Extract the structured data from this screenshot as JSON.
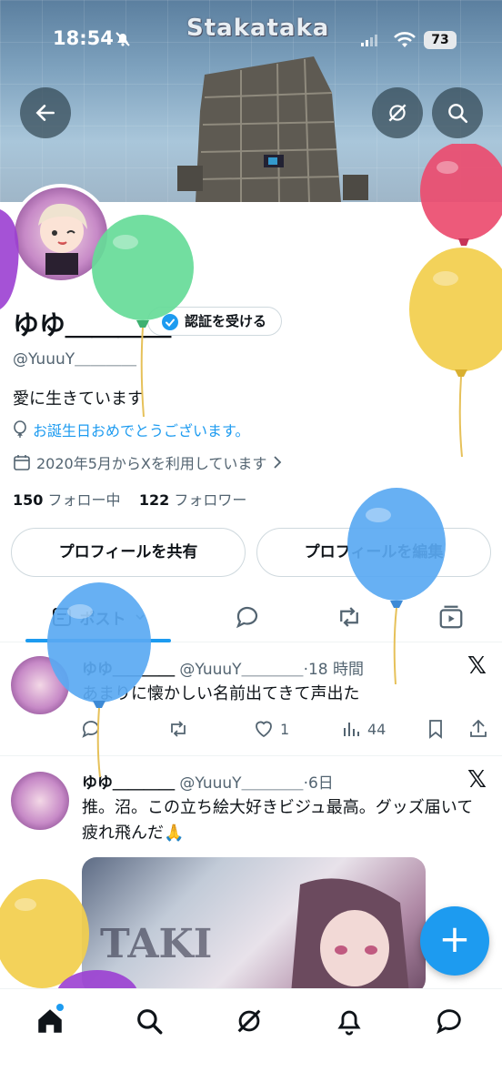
{
  "status_bar": {
    "time": "18:54",
    "battery": "73"
  },
  "banner": {
    "title": "Stakataka"
  },
  "profile": {
    "name": "ゆゆ＿＿＿＿",
    "handle": "@YuuuY＿＿＿＿",
    "verify_button": "認証を受ける",
    "bio": "愛に生きています",
    "birthday_text": "お誕生日おめでとうございます。",
    "joined_text": "2020年5月からXを利用しています",
    "following_count": "150",
    "following_label": "フォロー中",
    "followers_count": "122",
    "followers_label": "フォロワー"
  },
  "buttons": {
    "share": "プロフィールを共有",
    "edit": "プロフィールを編集"
  },
  "tabs": [
    {
      "label": "ポスト",
      "icon": "posts-icon",
      "active": true
    },
    {
      "label": "",
      "icon": "reply-icon"
    },
    {
      "label": "",
      "icon": "repost-icon"
    },
    {
      "label": "",
      "icon": "media-icon"
    }
  ],
  "posts": [
    {
      "name": "ゆゆ＿＿＿＿",
      "handle": "@YuuuY＿＿＿＿",
      "time": "18 時間",
      "text": "あまりに懐かしい名前出てきて声出た",
      "likes": "1",
      "views": "44"
    },
    {
      "name": "ゆゆ＿＿＿＿",
      "handle": "@YuuuY＿＿＿＿",
      "time": "6日",
      "text": "推。沼。この立ち絵大好きビジュ最高。グッズ届いて疲れ飛んだ🙏",
      "media_label": "TAKI"
    }
  ],
  "fab_label": "+",
  "colors": {
    "accent": "#1d9bf0",
    "text": "#0f1419",
    "secondary": "#536471"
  }
}
